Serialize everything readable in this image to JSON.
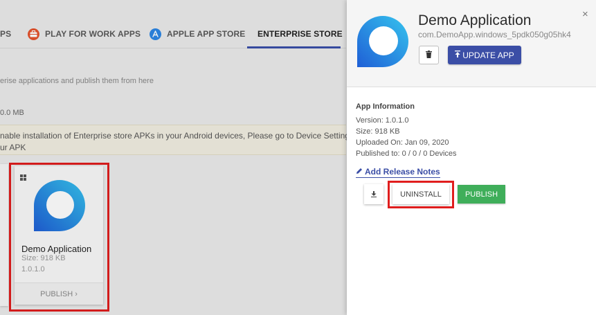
{
  "tabs": [
    {
      "label": "PS",
      "icon": ""
    },
    {
      "label": "PLAY FOR WORK APPS",
      "icon": "briefcase-icon",
      "color": "#e5532d"
    },
    {
      "label": "APPLE APP STORE",
      "icon": "app-store-icon",
      "color": "#2d86e5"
    },
    {
      "label": "ENTERPRISE STORE",
      "icon": "",
      "active": true
    }
  ],
  "page": {
    "description": "erise applications and publish them from here",
    "storage": "0.0 MB",
    "notice_line1": "nable installation of Enterprise store APKs in your Android devices, Please go to Device Settings ->",
    "notice_line2": "ur APK"
  },
  "card": {
    "platform_icon": "windows-icon",
    "name": "Demo Application",
    "size": "Size: 918 KB",
    "version": "1.0.1.0",
    "publish_label": "PUBLISH",
    "publish_chevron": "›"
  },
  "drawer": {
    "title": "Demo Application",
    "package": "com.DemoApp.windows_5pdk050g05hk4",
    "close_glyph": "×",
    "update_label": "UPDATE APP",
    "info_title": "App Information",
    "version": "Version: 1.0.1.0",
    "size": "Size: 918 KB",
    "uploaded": "Uploaded On: Jan 09, 2020",
    "published_to": "Published to: 0 / 0 / 0 Devices",
    "release_notes_label": "Add Release Notes",
    "uninstall_label": "UNINSTALL",
    "publish_label": "PUBLISH"
  },
  "colors": {
    "primary": "#3b4ea6",
    "publish_green": "#3fae5a",
    "highlight_red": "#e01d1d"
  }
}
